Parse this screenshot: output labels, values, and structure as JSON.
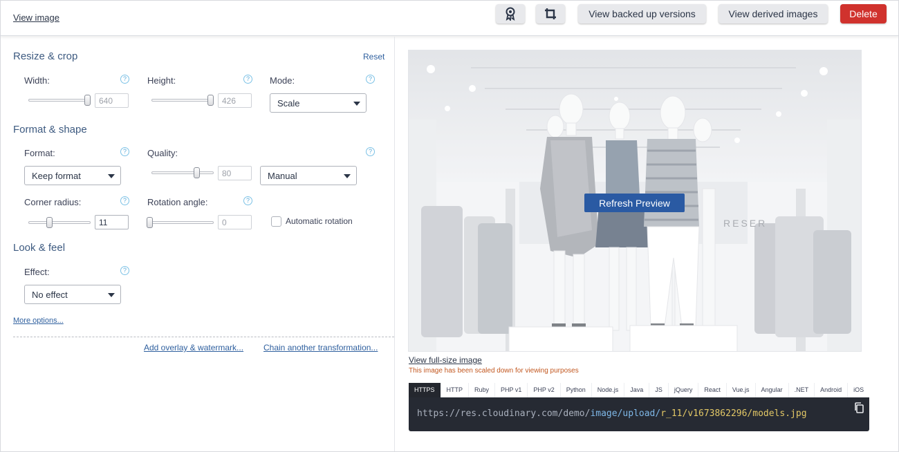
{
  "header": {
    "view_image": "View image",
    "view_backed_up": "View backed up versions",
    "view_derived": "View derived images",
    "delete": "Delete",
    "icons": [
      "badge-icon",
      "crop-icon"
    ]
  },
  "resize": {
    "title": "Resize & crop",
    "reset": "Reset",
    "width_label": "Width:",
    "width_value": "640",
    "height_label": "Height:",
    "height_value": "426",
    "mode_label": "Mode:",
    "mode_value": "Scale"
  },
  "format": {
    "title": "Format & shape",
    "format_label": "Format:",
    "format_value": "Keep format",
    "quality_label": "Quality:",
    "quality_value": "80",
    "quality_mode": "Manual",
    "radius_label": "Corner radius:",
    "radius_value": "11",
    "rotation_label": "Rotation angle:",
    "rotation_value": "0",
    "auto_rotation": "Automatic rotation"
  },
  "look": {
    "title": "Look & feel",
    "effect_label": "Effect:",
    "effect_value": "No effect"
  },
  "links": {
    "more_options": "More options...",
    "add_overlay": "Add overlay & watermark...",
    "chain": "Chain another transformation..."
  },
  "preview": {
    "refresh": "Refresh Preview",
    "full_size": "View full-size image",
    "scaled_note": "This image has been scaled down for viewing purposes",
    "store_sign": "RESER"
  },
  "code": {
    "tabs": [
      "HTTPS",
      "HTTP",
      "Ruby",
      "PHP v1",
      "PHP v2",
      "Python",
      "Node.js",
      "Java",
      "JS",
      "jQuery",
      "React",
      "Vue.js",
      "Angular",
      ".NET",
      "Android",
      "iOS"
    ],
    "active_tab": "HTTPS",
    "url_base": "https://res.cloudinary.com/demo/",
    "url_path": "image/upload/",
    "url_transform": "r_11",
    "url_file": "/v1673862296/models.jpg"
  },
  "colors": {
    "accent": "#2a5aa3",
    "delete": "#d0322d",
    "code_bg": "#262a33"
  }
}
